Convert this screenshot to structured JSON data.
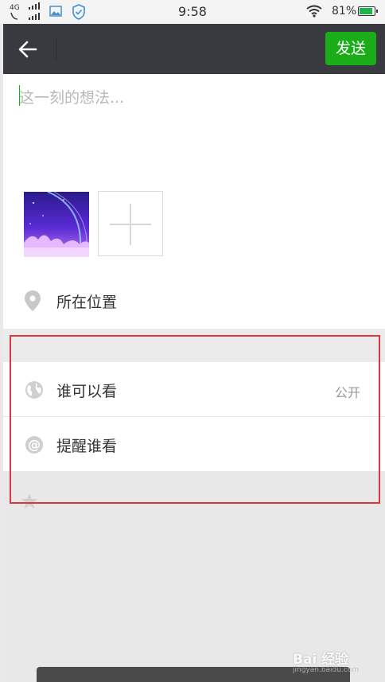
{
  "status_bar": {
    "network": "4G",
    "time": "9:58",
    "battery": "81%"
  },
  "header": {
    "send_label": "发送"
  },
  "compose": {
    "placeholder": "这一刻的想法..."
  },
  "location": {
    "label": "所在位置"
  },
  "privacy": {
    "who_can_see_label": "谁可以看",
    "who_can_see_value": "公开",
    "remind_label": "提醒谁看"
  },
  "watermark": {
    "main": "Bai 经验",
    "sub": "jingyan.baidu.com"
  },
  "colors": {
    "header_bg": "#393a3f",
    "accent_green": "#1aad19",
    "highlight_red": "#d9393d"
  }
}
